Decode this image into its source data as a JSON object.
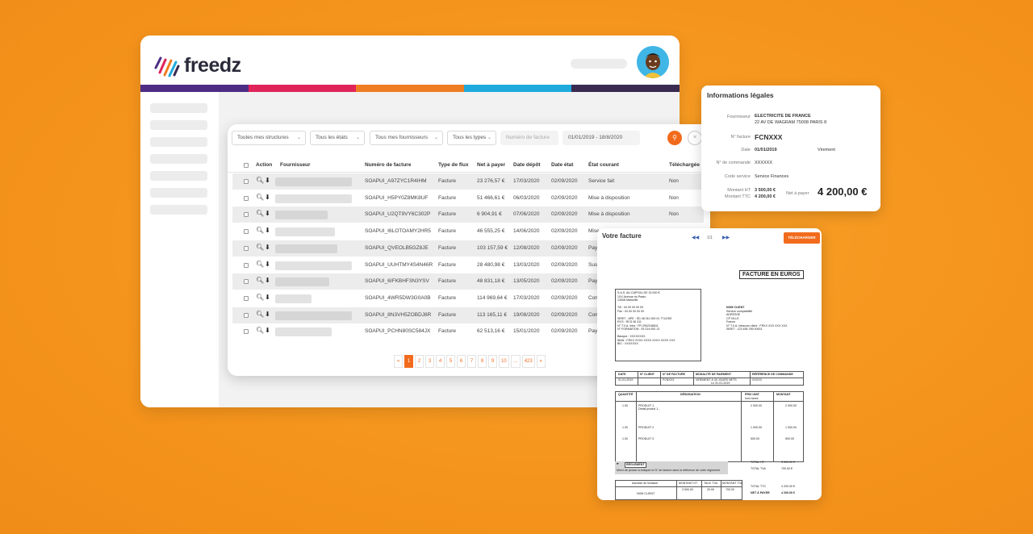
{
  "brand": {
    "name": "freedz"
  },
  "stripe_colors": [
    "#4d2d83",
    "#e0245a",
    "#ef7d22",
    "#1eaadc",
    "#3a2a4f"
  ],
  "filters": {
    "structures": "Toutes mes structures",
    "etats": "Tous les états",
    "fournisseurs": "Tous mes fournisseurs",
    "types": "Tous les types",
    "numero_placeholder": "Numéro de facture",
    "date_range": "01/01/2019 - 18/8/2020"
  },
  "table": {
    "columns": [
      "Action",
      "Fournisseur",
      "Numéro de facture",
      "Type de flux",
      "Net à payer",
      "Date dépôt",
      "Date état",
      "État courant",
      "Téléchargée"
    ],
    "rows": [
      {
        "numero": "SOAPUI_A97ZYC1R4IHM",
        "type": "Facture",
        "net": "23 276,57 €",
        "depot": "17/03/2020",
        "etat_date": "02/09/2020",
        "etat": "Service fait",
        "dl": "Non",
        "bar": 0.98
      },
      {
        "numero": "SOAPUI_H5PY0Z8MK8UF",
        "type": "Facture",
        "net": "51 466,61 €",
        "depot": "06/03/2020",
        "etat_date": "02/09/2020",
        "etat": "Mise à disposition",
        "dl": "Non",
        "bar": 0.98
      },
      {
        "numero": "SOAPUI_U2QT9VY6C302P",
        "type": "Facture",
        "net": "6 904,91 €",
        "depot": "07/06/2020",
        "etat_date": "02/09/2020",
        "etat": "Mise à disposition",
        "dl": "Non",
        "bar": 0.67
      },
      {
        "numero": "SOAPUI_I6LOTOAMY2HR5",
        "type": "Facture",
        "net": "46 555,25 €",
        "depot": "14/06/2020",
        "etat_date": "02/09/2020",
        "etat": "Mise",
        "dl": "",
        "bar": 0.76
      },
      {
        "numero": "SOAPUI_QVEOLB5GZ8JE",
        "type": "Facture",
        "net": "103 157,59 €",
        "depot": "12/08/2020",
        "etat_date": "02/09/2020",
        "etat": "Paye",
        "dl": "",
        "bar": 0.79
      },
      {
        "numero": "SOAPUI_UUHTMY4S4N46R",
        "type": "Facture",
        "net": "28 480,98 €",
        "depot": "13/03/2020",
        "etat_date": "02/09/2020",
        "etat": "Susp",
        "dl": "",
        "bar": 0.98
      },
      {
        "numero": "SOAPUI_6IFKBHF3N3YSV",
        "type": "Facture",
        "net": "48 831,18 €",
        "depot": "13/05/2020",
        "etat_date": "02/09/2020",
        "etat": "Paye",
        "dl": "",
        "bar": 0.69
      },
      {
        "numero": "SOAPUI_4WR5DW3G0A0B",
        "type": "Facture",
        "net": "114 969,64 €",
        "depot": "17/03/2020",
        "etat_date": "02/09/2020",
        "etat": "Com",
        "dl": "",
        "bar": 0.46
      },
      {
        "numero": "SOAPUI_8N3VH5ZOBDJ8R",
        "type": "Facture",
        "net": "113 165,11 €",
        "depot": "19/08/2020",
        "etat_date": "02/09/2020",
        "etat": "Com",
        "dl": "",
        "bar": 0.98
      },
      {
        "numero": "SOAPUI_PCHN80SC584JX",
        "type": "Facture",
        "net": "62 513,16 €",
        "depot": "15/01/2020",
        "etat_date": "02/09/2020",
        "etat": "Paye",
        "dl": "",
        "bar": 0.72
      }
    ]
  },
  "pagination": {
    "prev": "«",
    "pages": [
      "1",
      "2",
      "3",
      "4",
      "5",
      "6",
      "7",
      "8",
      "9",
      "10",
      "…",
      "423"
    ],
    "next": "»",
    "current": "1"
  },
  "legal": {
    "title": "Informations légales",
    "fournisseur_label": "Fournisseur",
    "fournisseur_name": "ELECTRICITE DE FRANCE",
    "fournisseur_address": "22 AV DE WAGRAM 75008 PARIS 8",
    "facture_label": "N° facture",
    "facture_value": "FCNXXX",
    "date_label": "Date",
    "date_value": "01/01/2019",
    "mode_value": "Virement",
    "commande_label": "N° de commande",
    "commande_value": "XXXXXX",
    "service_label": "Code service",
    "service_value": "Service Finances",
    "ht_label": "Montant HT",
    "ht_value": "3 500,00 €",
    "ttc_label": "Montant TTC",
    "ttc_value": "4 200,00 €",
    "net_label": "Net à payer",
    "net_value": "4 200,00 €"
  },
  "invoice": {
    "title": "Votre facture",
    "prev": "◀◀",
    "page": "1/1",
    "next": "▶▶",
    "download": "TÉLÉCHARGER",
    "doc_title": "FACTURE EN EUROS",
    "seller_lines": [
      "S.A.S. AU CAPITAL DE 15 000 €",
      "1XX Avenue du Prado",
      "13008 Marseille",
      "",
      "Tél :      04 00 00 00 00",
      "Fax :      04 00 00 00 00",
      "",
      "SIRET - APE :      SD 48 311 000 01 771Z/DE",
      "RCS :      RCS 46 311",
      "N° T.V.A. intra :      FR 2902248611",
      "N° FORMATION :      93 314 000 13",
      "",
      "Banque :      XXXXXXXX",
      "IBAN :      FRXX XXXX XXXX XXXX XXXX XXX",
      "BIC :      XXXXXXX"
    ],
    "client_lines": [
      "NOM CLIENT",
      "Service comptabilité",
      "ADRESSE",
      "CP   VILLE",
      "France",
      "N° T.V.A. intracom client : FRXX XXX XXX XXX",
      "SIRET : 123 456 789 00001"
    ],
    "info_headers": [
      "DATE",
      "N° CLIENT",
      "N° DE FACTURE",
      "MODALITÉ DE PAIEMENT",
      "RÉFÉRENCE DE COMMANDE"
    ],
    "info_values": [
      "01-01-2019",
      "",
      "FCNXXX",
      "VIREMENT À 30 JOURS NETS",
      "XXXXX"
    ],
    "info_sub": "Le 31-01-2019",
    "lines_headers": [
      "QUANTITÉ",
      "DÉSIGNATION",
      "PRIX UNIT.",
      "MONTANT"
    ],
    "prix_sub": "hors taxes",
    "lines": [
      {
        "qte": "1.00",
        "designation": "PRODUIT 1",
        "detail": "Détail produit 1...",
        "prix": "2 000.00",
        "montant": "2 000.00"
      },
      {
        "qte": "1.00",
        "designation": "PRODUIT 2",
        "detail": "",
        "prix": "1 000.00",
        "montant": "1 000.00"
      },
      {
        "qte": "1.00",
        "designation": "PRODUIT 3",
        "detail": "",
        "prix": "500.00",
        "montant": "500.00"
      }
    ],
    "reglement_label": "RÉGLEMENT",
    "reglement_note": "Merci de penser à indiquer le N° de facture dans la référence de votre règlement",
    "total_ht_label": "TOTAL HT",
    "total_ht": "3 500.00 €",
    "total_tva_label": "TOTAL TVA",
    "total_tva": "700.00 €",
    "tax_headers": [
      "Adresse de livraison",
      "MONTANT HT",
      "TAUX TVA",
      "MONTANT TVA"
    ],
    "tax_values": [
      "3 500.00",
      "20.00",
      "700.00"
    ],
    "livraison": "NOM CLIENT",
    "total_ttc_label": "TOTAL TTC",
    "total_ttc": "4 200.00 €",
    "net_label": "NET À PAYER",
    "net": "4 200.00 €"
  }
}
